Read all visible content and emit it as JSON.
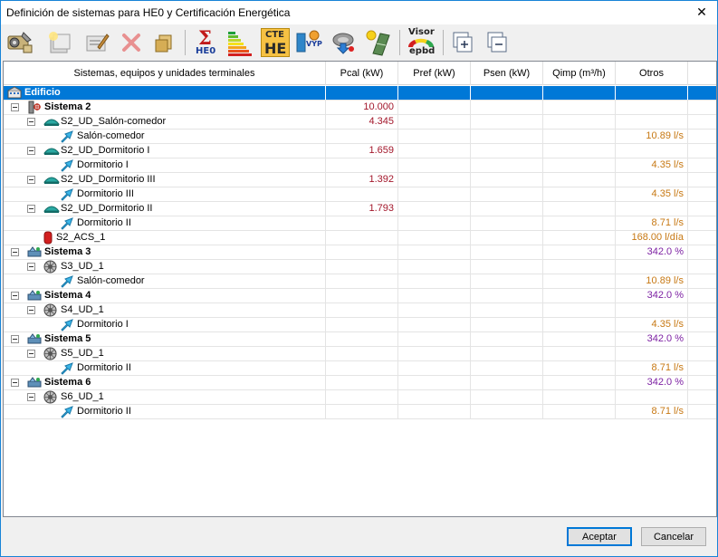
{
  "window": {
    "title": "Definición de sistemas para HE0 y Certificación Energética",
    "close_glyph": "✕"
  },
  "toolbar": {
    "items": [
      {
        "icon": "system-config-icon"
      },
      {
        "icon": "new-item-icon"
      },
      {
        "icon": "edit-icon"
      },
      {
        "icon": "delete-icon"
      },
      {
        "icon": "copy-icon"
      },
      {
        "icon": "sum-he0-icon",
        "label": "HE0",
        "glyph": "Σ"
      },
      {
        "icon": "energy-rating-icon"
      },
      {
        "icon": "cte-he-icon",
        "label_top": "CTE",
        "label_bottom": "HE"
      },
      {
        "icon": "vyp-icon",
        "label": "VYP"
      },
      {
        "icon": "download-globe-icon"
      },
      {
        "icon": "solar-panel-icon"
      },
      {
        "icon": "visor-epbd-icon",
        "label_top": "Visor",
        "label_bottom": "epbd"
      },
      {
        "icon": "expand-all-icon"
      },
      {
        "icon": "collapse-all-icon"
      }
    ]
  },
  "table": {
    "columns": [
      "Sistemas, equipos y unidades terminales",
      "Pcal (kW)",
      "Pref (kW)",
      "Psen (kW)",
      "Qimp (m³/h)",
      "Otros"
    ],
    "rows": [
      {
        "level": 0,
        "type": "building",
        "label": "Edificio",
        "pcal": "",
        "otros": "",
        "selected": true
      },
      {
        "level": 0,
        "type": "system-hp",
        "label": "Sistema 2",
        "pcal": "10.000",
        "otros": "",
        "bold": true,
        "exp": true
      },
      {
        "level": 1,
        "type": "unit-split",
        "label": "S2_UD_Salón-comedor",
        "pcal": "4.345",
        "otros": "",
        "exp": true
      },
      {
        "level": 2,
        "type": "terminal",
        "label": "Salón-comedor",
        "pcal": "",
        "otros": "10.89 l/s",
        "otros_kind": "flow"
      },
      {
        "level": 1,
        "type": "unit-split",
        "label": "S2_UD_Dormitorio I",
        "pcal": "1.659",
        "otros": "",
        "exp": true
      },
      {
        "level": 2,
        "type": "terminal",
        "label": "Dormitorio I",
        "pcal": "",
        "otros": "4.35 l/s",
        "otros_kind": "flow"
      },
      {
        "level": 1,
        "type": "unit-split",
        "label": "S2_UD_Dormitorio III",
        "pcal": "1.392",
        "otros": "",
        "exp": true
      },
      {
        "level": 2,
        "type": "terminal",
        "label": "Dormitorio III",
        "pcal": "",
        "otros": "4.35 l/s",
        "otros_kind": "flow"
      },
      {
        "level": 1,
        "type": "unit-split",
        "label": "S2_UD_Dormitorio II",
        "pcal": "1.793",
        "otros": "",
        "exp": true
      },
      {
        "level": 2,
        "type": "terminal",
        "label": "Dormitorio II",
        "pcal": "",
        "otros": "8.71 l/s",
        "otros_kind": "flow"
      },
      {
        "level": 1,
        "type": "acs",
        "label": "S2_ACS_1",
        "pcal": "",
        "otros": "168.00 l/día",
        "otros_kind": "acs"
      },
      {
        "level": 0,
        "type": "system-vent",
        "label": "Sistema 3",
        "pcal": "",
        "otros": "342.0 %",
        "otros_kind": "pct",
        "bold": true,
        "exp": true
      },
      {
        "level": 1,
        "type": "unit-fan",
        "label": "S3_UD_1",
        "pcal": "",
        "otros": "",
        "exp": true
      },
      {
        "level": 2,
        "type": "terminal",
        "label": "Salón-comedor",
        "pcal": "",
        "otros": "10.89 l/s",
        "otros_kind": "flow"
      },
      {
        "level": 0,
        "type": "system-vent",
        "label": "Sistema 4",
        "pcal": "",
        "otros": "342.0 %",
        "otros_kind": "pct",
        "bold": true,
        "exp": true
      },
      {
        "level": 1,
        "type": "unit-fan",
        "label": "S4_UD_1",
        "pcal": "",
        "otros": "",
        "exp": true
      },
      {
        "level": 2,
        "type": "terminal",
        "label": "Dormitorio I",
        "pcal": "",
        "otros": "4.35 l/s",
        "otros_kind": "flow"
      },
      {
        "level": 0,
        "type": "system-vent",
        "label": "Sistema 5",
        "pcal": "",
        "otros": "342.0 %",
        "otros_kind": "pct",
        "bold": true,
        "exp": true
      },
      {
        "level": 1,
        "type": "unit-fan",
        "label": "S5_UD_1",
        "pcal": "",
        "otros": "",
        "exp": true
      },
      {
        "level": 2,
        "type": "terminal",
        "label": "Dormitorio II",
        "pcal": "",
        "otros": "8.71 l/s",
        "otros_kind": "flow"
      },
      {
        "level": 0,
        "type": "system-vent",
        "label": "Sistema 6",
        "pcal": "",
        "otros": "342.0 %",
        "otros_kind": "pct",
        "bold": true,
        "exp": true
      },
      {
        "level": 1,
        "type": "unit-fan",
        "label": "S6_UD_1",
        "pcal": "",
        "otros": "",
        "exp": true
      },
      {
        "level": 2,
        "type": "terminal",
        "label": "Dormitorio II",
        "pcal": "",
        "otros": "8.71 l/s",
        "otros_kind": "flow"
      }
    ]
  },
  "footer": {
    "accept_label": "Aceptar",
    "cancel_label": "Cancelar"
  }
}
